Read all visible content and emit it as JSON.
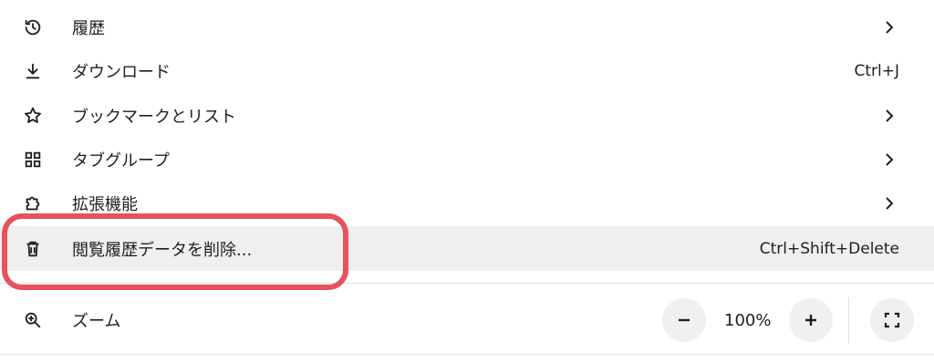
{
  "menu": {
    "items": [
      {
        "label": "履歴",
        "icon": "history-icon",
        "submenu": true
      },
      {
        "label": "ダウンロード",
        "icon": "download-icon",
        "shortcut": "Ctrl+J"
      },
      {
        "label": "ブックマークとリスト",
        "icon": "star-icon",
        "submenu": true
      },
      {
        "label": "タブグループ",
        "icon": "tab-groups-icon",
        "submenu": true
      },
      {
        "label": "拡張機能",
        "icon": "extension-puzzle-icon",
        "submenu": true
      },
      {
        "label": "閲覧履歴データを削除...",
        "icon": "trash-icon",
        "shortcut": "Ctrl+Shift+Delete",
        "highlighted": true
      }
    ],
    "zoom": {
      "label": "ズーム",
      "icon": "zoom-in-icon",
      "value": "100%",
      "minus": "−",
      "plus": "+"
    }
  },
  "colors": {
    "highlight_outline": "#e8525a",
    "hover_row": "#efefef",
    "text": "#1f1f1f"
  }
}
